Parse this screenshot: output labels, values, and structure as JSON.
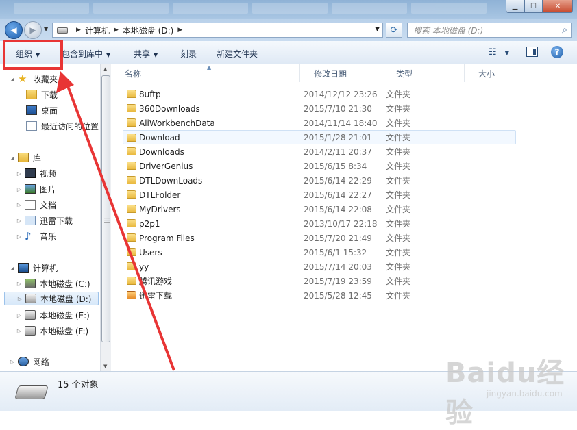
{
  "address": {
    "crumbs": [
      "计算机",
      "本地磁盘 (D:)"
    ],
    "search_placeholder": "搜索 本地磁盘 (D:)"
  },
  "toolbar": {
    "organize": "组织",
    "include_library": "包含到库中",
    "share": "共享",
    "burn": "刻录",
    "new_folder": "新建文件夹"
  },
  "navpane": {
    "favorites": "收藏夹",
    "downloads": "下载",
    "desktop": "桌面",
    "recent": "最近访问的位置",
    "libraries": "库",
    "videos": "视频",
    "pictures": "图片",
    "documents": "文档",
    "thunder": "迅雷下载",
    "music": "音乐",
    "computer": "计算机",
    "drive_c": "本地磁盘 (C:)",
    "drive_d": "本地磁盘 (D:)",
    "drive_e": "本地磁盘 (E:)",
    "drive_f": "本地磁盘 (F:)",
    "network": "网络"
  },
  "columns": {
    "name": "名称",
    "date": "修改日期",
    "type": "类型",
    "size": "大小"
  },
  "files": [
    {
      "name": "8uftp",
      "date": "2014/12/12 23:26",
      "type": "文件夹"
    },
    {
      "name": "360Downloads",
      "date": "2015/7/10 21:30",
      "type": "文件夹"
    },
    {
      "name": "AliWorkbenchData",
      "date": "2014/11/14 18:40",
      "type": "文件夹"
    },
    {
      "name": "Download",
      "date": "2015/1/28 21:01",
      "type": "文件夹"
    },
    {
      "name": "Downloads",
      "date": "2014/2/11 20:37",
      "type": "文件夹"
    },
    {
      "name": "DriverGenius",
      "date": "2015/6/15 8:34",
      "type": "文件夹"
    },
    {
      "name": "DTLDownLoads",
      "date": "2015/6/14 22:29",
      "type": "文件夹"
    },
    {
      "name": "DTLFolder",
      "date": "2015/6/14 22:27",
      "type": "文件夹"
    },
    {
      "name": "MyDrivers",
      "date": "2015/6/14 22:08",
      "type": "文件夹"
    },
    {
      "name": "p2p1",
      "date": "2013/10/17 22:18",
      "type": "文件夹"
    },
    {
      "name": "Program Files",
      "date": "2015/7/20 21:49",
      "type": "文件夹"
    },
    {
      "name": "Users",
      "date": "2015/6/1 15:32",
      "type": "文件夹"
    },
    {
      "name": "yy",
      "date": "2015/7/14 20:03",
      "type": "文件夹"
    },
    {
      "name": "腾讯游戏",
      "date": "2015/7/19 23:59",
      "type": "文件夹"
    },
    {
      "name": "迅雷下载",
      "date": "2015/5/28 12:45",
      "type": "文件夹"
    }
  ],
  "status": {
    "count": "15 个对象"
  },
  "watermark": {
    "main": "Baidu经验",
    "sub": "jingyan.baidu.com"
  },
  "colors": {
    "highlight": "#e83535",
    "selection": "#cfe1f5"
  }
}
